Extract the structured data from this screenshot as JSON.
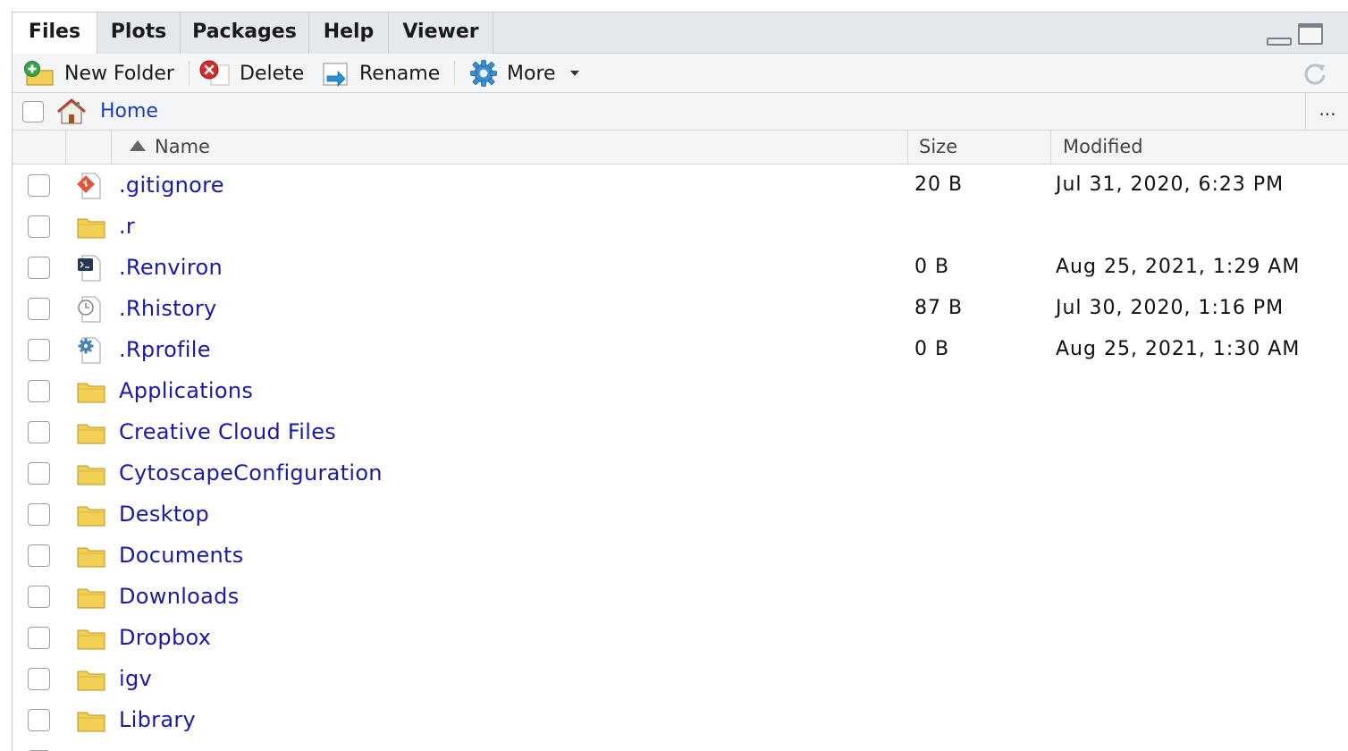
{
  "tabs": [
    {
      "label": "Files",
      "active": true
    },
    {
      "label": "Plots",
      "active": false
    },
    {
      "label": "Packages",
      "active": false
    },
    {
      "label": "Help",
      "active": false
    },
    {
      "label": "Viewer",
      "active": false
    }
  ],
  "toolbar": {
    "new_folder_label": "New Folder",
    "delete_label": "Delete",
    "rename_label": "Rename",
    "more_label": "More"
  },
  "breadcrumb": {
    "home_label": "Home",
    "more_label": "..."
  },
  "columns": {
    "name": "Name",
    "size": "Size",
    "modified": "Modified"
  },
  "colors": {
    "link": "#1a1aa6",
    "folder": "#f2cf55",
    "git": "#e2553a"
  },
  "files": [
    {
      "name": ".gitignore",
      "icon": "git-file-icon",
      "size": "20 B",
      "modified": "Jul 31, 2020, 6:23 PM"
    },
    {
      "name": ".r",
      "icon": "folder-icon",
      "size": "",
      "modified": ""
    },
    {
      "name": ".Renviron",
      "icon": "terminal-file-icon",
      "size": "0 B",
      "modified": "Aug 25, 2021, 1:29 AM"
    },
    {
      "name": ".Rhistory",
      "icon": "history-file-icon",
      "size": "87 B",
      "modified": "Jul 30, 2020, 1:16 PM"
    },
    {
      "name": ".Rprofile",
      "icon": "settings-file-icon",
      "size": "0 B",
      "modified": "Aug 25, 2021, 1:30 AM"
    },
    {
      "name": "Applications",
      "icon": "folder-icon",
      "size": "",
      "modified": ""
    },
    {
      "name": "Creative Cloud Files",
      "icon": "folder-icon",
      "size": "",
      "modified": ""
    },
    {
      "name": "CytoscapeConfiguration",
      "icon": "folder-icon",
      "size": "",
      "modified": ""
    },
    {
      "name": "Desktop",
      "icon": "folder-icon",
      "size": "",
      "modified": ""
    },
    {
      "name": "Documents",
      "icon": "folder-icon",
      "size": "",
      "modified": ""
    },
    {
      "name": "Downloads",
      "icon": "folder-icon",
      "size": "",
      "modified": ""
    },
    {
      "name": "Dropbox",
      "icon": "folder-icon",
      "size": "",
      "modified": ""
    },
    {
      "name": "igv",
      "icon": "folder-icon",
      "size": "",
      "modified": ""
    },
    {
      "name": "Library",
      "icon": "folder-icon",
      "size": "",
      "modified": ""
    },
    {
      "name": "",
      "icon": "folder-icon",
      "size": "",
      "modified": ""
    }
  ]
}
